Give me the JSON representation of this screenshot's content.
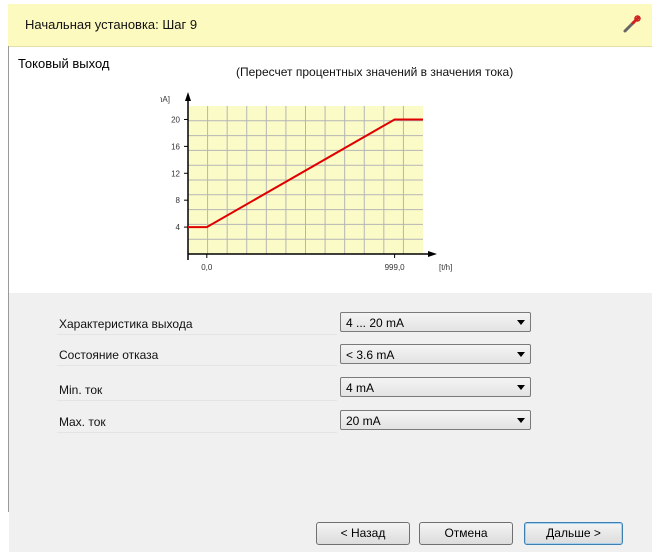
{
  "header": {
    "title": "Начальная установка: Шаг 9",
    "icon": "wrench-icon"
  },
  "section": {
    "title": "Токовый выход"
  },
  "chart_data": {
    "type": "line",
    "title": "(Пересчет процентных значений в значения тока)",
    "ylabel": "[mA]",
    "xlabel": "[t/h]",
    "y_ticks": [
      "4",
      "8",
      "12",
      "16",
      "20"
    ],
    "x_ticks": [
      "0,0",
      "999,0"
    ],
    "ylim": [
      0,
      22
    ],
    "xlim": [
      -100,
      1150
    ],
    "grid": true,
    "series": [
      {
        "color": "#e00000",
        "x": [
          -100,
          0,
          999,
          1150
        ],
        "y": [
          4,
          4,
          20,
          20
        ]
      }
    ]
  },
  "settings": [
    {
      "label": "Характеристика выхода",
      "value": "4 ... 20 mA"
    },
    {
      "label": "Состояние отказа",
      "value": "< 3.6 mA"
    },
    {
      "label": "Min. ток",
      "value": "4 mA"
    },
    {
      "label": "Max. ток",
      "value": "20 mA"
    }
  ],
  "buttons": {
    "back": "< Назад",
    "cancel": "Отмена",
    "next": "Дальше >"
  },
  "colors": {
    "header_bg": "#fdfac0",
    "plot_bg": "#fbfbc8",
    "line": "#e00000",
    "panel_bg": "#f0f0f0"
  }
}
